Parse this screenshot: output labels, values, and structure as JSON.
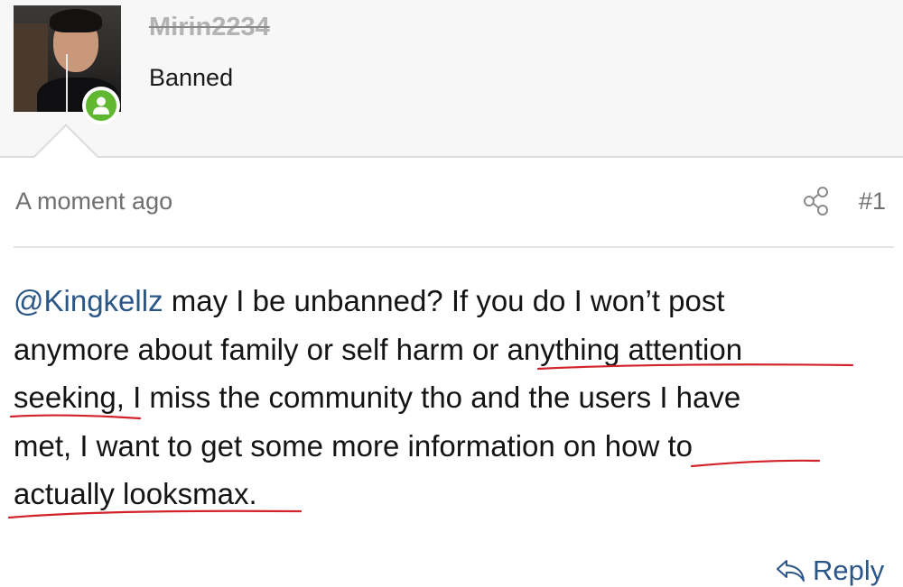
{
  "user": {
    "name": "Mirin2234",
    "title": "Banned",
    "status_color": "#5fb830",
    "status_icon": "user-online-icon"
  },
  "post": {
    "time": "A moment ago",
    "number": "#1",
    "share_icon": "share-icon",
    "mention": "@Kingkellz",
    "lines": [
      " may I be unbanned? If you do I won’t post",
      "anymore about family or self harm or anything attention",
      "seeking, I miss the community tho and the users I have",
      "met, I want to get some more information on how to",
      "actually looksmax."
    ],
    "underline_color": "#d2232a"
  },
  "actions": {
    "reply_label": "Reply",
    "reply_icon": "reply-arrow-icon"
  }
}
